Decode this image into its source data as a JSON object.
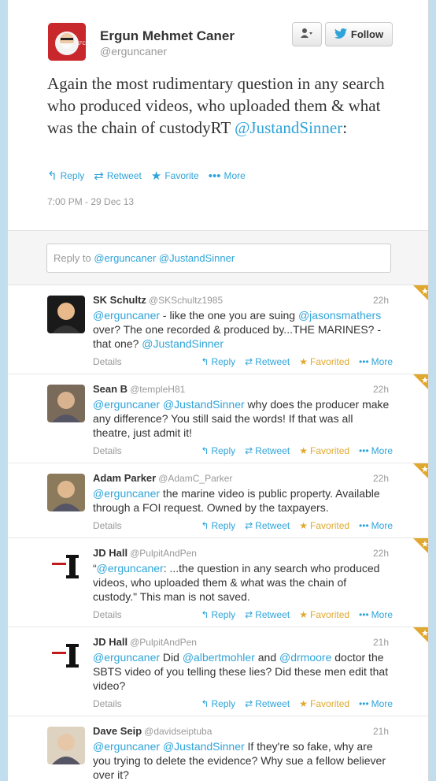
{
  "tweet": {
    "name": "Ergun Mehmet Caner",
    "handle": "@erguncaner",
    "follow_label": "Follow",
    "text_before": "Again the most rudimentary question in any search who produced videos, who uploaded them & what was the chain of custodyRT ",
    "mention": "@JustandSinner",
    "text_after": ":",
    "actions": {
      "reply": "Reply",
      "retweet": "Retweet",
      "favorite": "Favorite",
      "more": "More"
    },
    "timestamp": "7:00 PM - 29 Dec 13"
  },
  "reply_input": {
    "prefix": "Reply to ",
    "mentions": "@erguncaner @JustandSinner"
  },
  "replies": [
    {
      "name": "SK Schultz",
      "handle": "@SKSchultz1985",
      "time": "22h",
      "details": "Details",
      "p1": "@erguncaner",
      "p2": " - like the one you are suing ",
      "p3": "@jasonsmathers",
      "p4": " over? The one recorded & produced by...THE MARINES? - that one? ",
      "p5": "@JustandSinner",
      "p6": ""
    },
    {
      "name": "Sean B",
      "handle": "@templeH81",
      "time": "22h",
      "details": "Details",
      "p1": "@erguncaner",
      "p2": " ",
      "p3": "@JustandSinner",
      "p4": " why does the producer make any difference? You still said the words! If that was all theatre, just admit it!",
      "p5": "",
      "p6": ""
    },
    {
      "name": "Adam Parker",
      "handle": "@AdamC_Parker",
      "time": "22h",
      "details": "Details",
      "p1": "@erguncaner",
      "p2": " the marine video is public property. Available through a FOI request. Owned by the taxpayers.",
      "p3": "",
      "p4": "",
      "p5": "",
      "p6": ""
    },
    {
      "name": "JD Hall",
      "handle": "@PulpitAndPen",
      "time": "22h",
      "details": "Details",
      "p1": "“",
      "p2": "",
      "p3": "@erguncaner",
      "p4": ": ...the question in any search who produced videos, who uploaded them & what was the chain of custody.\" This man is not saved.",
      "p5": "",
      "p6": ""
    },
    {
      "name": "JD Hall",
      "handle": "@PulpitAndPen",
      "time": "21h",
      "details": "Details",
      "p1": "@erguncaner",
      "p2": " Did ",
      "p3": "@albertmohler",
      "p4": " and ",
      "p5": "@drmoore",
      "p6": " doctor the SBTS video of you telling these lies? Did these men edit that video?"
    },
    {
      "name": "Dave Seip",
      "handle": "@davidseiptuba",
      "time": "21h",
      "details": "",
      "p1": "@erguncaner",
      "p2": " ",
      "p3": "@JustandSinner",
      "p4": " If they're so fake, why are you trying to delete the evidence? Why sue a fellow believer over it?",
      "p5": "",
      "p6": ""
    }
  ],
  "reply_actions": {
    "reply": "Reply",
    "retweet": "Retweet",
    "favorited": "Favorited",
    "more": "More"
  },
  "colors": {
    "link": "#2fa4d9",
    "favorited": "#e0a82e",
    "background": "#c0deed"
  }
}
